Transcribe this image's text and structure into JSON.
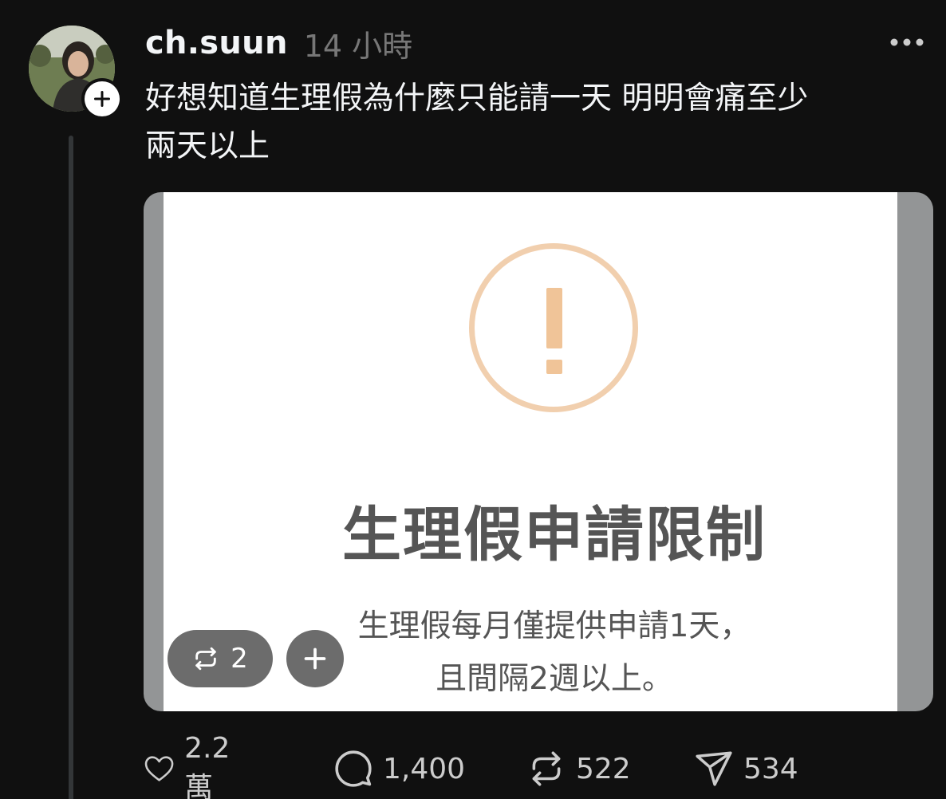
{
  "post": {
    "username": "ch.suun",
    "timestamp": "14 小時",
    "text_line1": "好想知道生理假為什麼只能請一天 明明會痛至少",
    "text_line2": "兩天以上"
  },
  "media": {
    "title": "生理假申請限制",
    "body_line1": "生理假每月僅提供申請1天，",
    "body_line2": "且間隔2週以上。",
    "warning_color": "#f0c498"
  },
  "overlay": {
    "repost_count": "2"
  },
  "actions": {
    "likes": "2.2萬",
    "replies": "1,400",
    "reposts": "522",
    "shares": "534"
  },
  "icons": {
    "avatar": "avatar-photo",
    "follow": "plus-icon",
    "more": "more-dots-icon",
    "like": "heart-icon",
    "reply": "comment-bubble-icon",
    "repost": "repost-icon",
    "share": "send-icon",
    "warning": "exclamation-circle-icon"
  },
  "colors": {
    "background": "#101010",
    "text": "#f3f5f7",
    "muted": "#777777",
    "thread_line": "#333638"
  }
}
